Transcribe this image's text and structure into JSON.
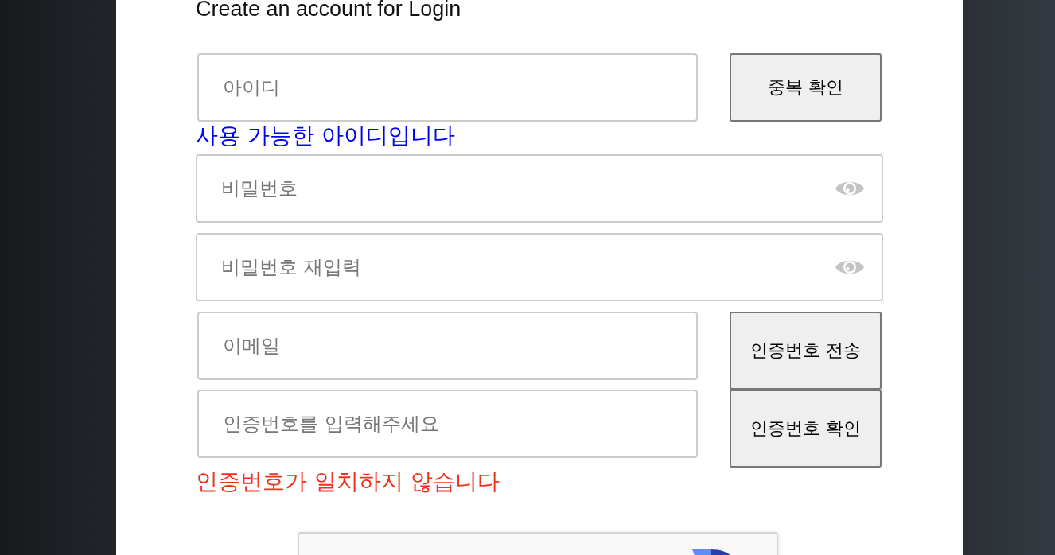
{
  "title": "Create an account for Login",
  "rows": [
    {
      "kind": "field-button",
      "placeholder": "아이디",
      "button": "중복 확인"
    },
    {
      "kind": "message",
      "color": "#0000ff",
      "text": "사용 가능한 아이디입니다"
    },
    {
      "kind": "password",
      "placeholder": "비밀번호"
    },
    {
      "kind": "password",
      "placeholder": "비밀번호 재입력"
    },
    {
      "kind": "field-button",
      "placeholder": "이메일",
      "button": "인증번호 전송"
    },
    {
      "kind": "field-button",
      "placeholder": "인증번호를 입력해주세요",
      "button": "인증번호 확인"
    },
    {
      "kind": "message",
      "color": "#f0311e",
      "text": "인증번호가 일치하지 않습니다"
    }
  ]
}
